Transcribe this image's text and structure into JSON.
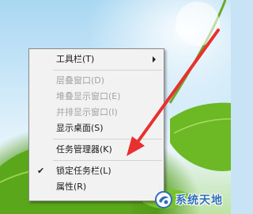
{
  "menu": {
    "items": [
      {
        "label": "工具栏(T)",
        "has_submenu": true,
        "enabled": true
      },
      {
        "label": "层叠窗口(D)",
        "enabled": false
      },
      {
        "label": "堆叠显示窗口(E)",
        "enabled": false
      },
      {
        "label": "并排显示窗口(I)",
        "enabled": false
      },
      {
        "label": "显示桌面(S)",
        "enabled": true
      },
      {
        "label": "任务管理器(K)",
        "enabled": true
      },
      {
        "label": "锁定任务栏(L)",
        "enabled": true,
        "checked": true
      },
      {
        "label": "属性(R)",
        "enabled": true
      }
    ]
  },
  "watermark": {
    "text": "系统天地"
  },
  "colors": {
    "arrow": "#e8312f",
    "watermark": "#2f6fb6",
    "menu_bg": "#f2f2f2",
    "disabled_text": "#a3a3a3"
  },
  "icons": {
    "submenu": "chevron-right-icon",
    "check": "checkmark-icon",
    "logo": "watermark-logo-icon"
  }
}
